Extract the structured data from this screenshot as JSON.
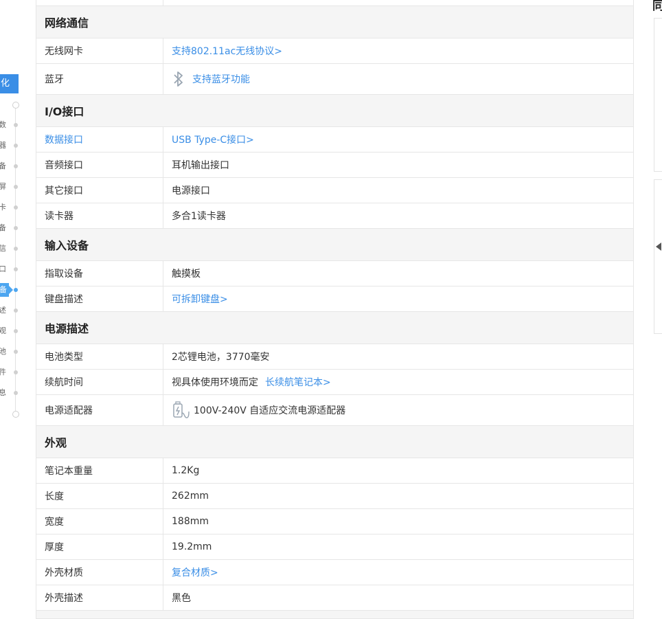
{
  "nav": {
    "active_top_label": "化",
    "items": [
      {
        "label": "数"
      },
      {
        "label": "器"
      },
      {
        "label": "备"
      },
      {
        "label": "屏"
      },
      {
        "label": "卡"
      },
      {
        "label": "备"
      },
      {
        "label": "信"
      },
      {
        "label": "口"
      },
      {
        "label": "备",
        "active": true
      },
      {
        "label": "述"
      },
      {
        "label": "观"
      },
      {
        "label": "池"
      },
      {
        "label": "件"
      },
      {
        "label": "息"
      }
    ]
  },
  "sections": {
    "network": {
      "title": "网络通信",
      "wireless_label": "无线网卡",
      "wireless_value": "支持802.11ac无线协议>",
      "bt_label": "蓝牙",
      "bt_value": "支持蓝牙功能"
    },
    "io": {
      "title": "I/O接口",
      "data_label": "数据接口",
      "data_value": "USB Type-C接口>",
      "audio_label": "音频接口",
      "audio_value": "耳机输出接口",
      "other_label": "其它接口",
      "other_value": "电源接口",
      "card_label": "读卡器",
      "card_value": "多合1读卡器"
    },
    "input": {
      "title": "输入设备",
      "pointing_label": "指取设备",
      "pointing_value": "触摸板",
      "keyboard_label": "键盘描述",
      "keyboard_value": "可拆卸键盘>"
    },
    "power": {
      "title": "电源描述",
      "battery_label": "电池类型",
      "battery_value": "2芯锂电池，3770毫安",
      "life_label": "续航时间",
      "life_value": "视具体使用环境而定",
      "life_link": "长续航笔记本>",
      "adapter_label": "电源适配器",
      "adapter_value": "100V-240V 自适应交流电源适配器"
    },
    "appearance": {
      "title": "外观",
      "weight_label": "笔记本重量",
      "weight_value": "1.2Kg",
      "length_label": "长度",
      "length_value": "262mm",
      "width_label": "宽度",
      "width_value": "188mm",
      "thickness_label": "厚度",
      "thickness_value": "19.2mm",
      "material_label": "外壳材质",
      "material_value": "复合材质>",
      "shell_label": "外壳描述",
      "shell_value": "黑色"
    }
  },
  "side": {
    "title_fragment": "同"
  },
  "colors": {
    "link": "#3a8ee6",
    "section_bg": "#f5f5f5",
    "border": "#e6e6e6",
    "nav_active": "#4da6f0"
  }
}
